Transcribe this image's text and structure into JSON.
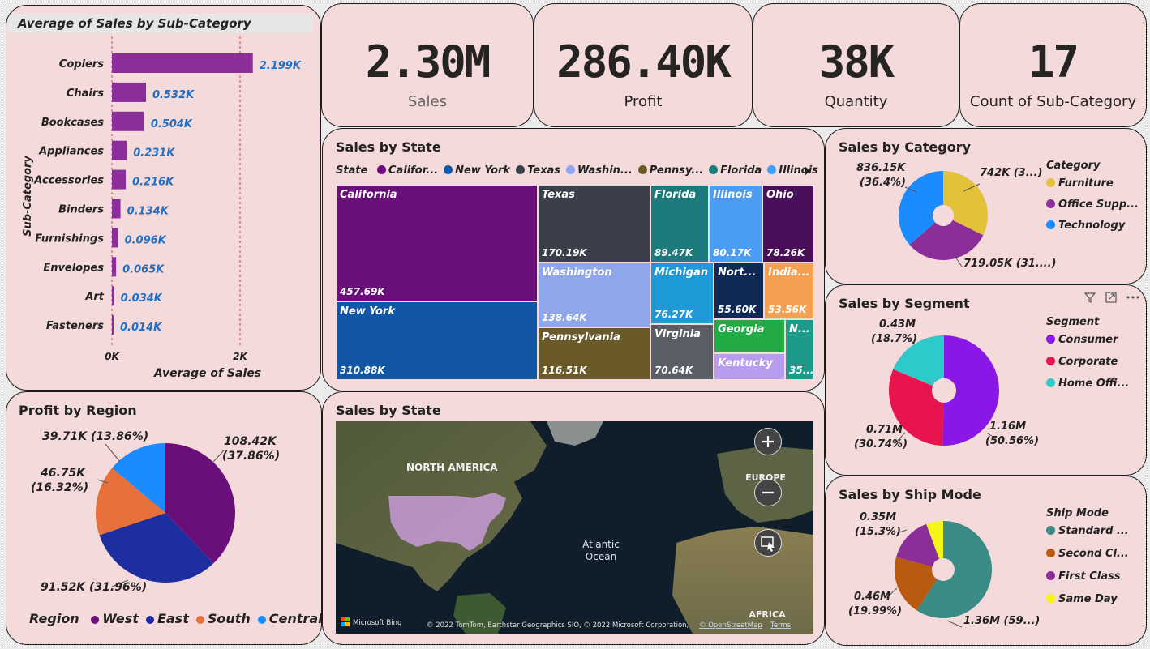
{
  "kpis": [
    {
      "value": "2.30M",
      "label": "Sales"
    },
    {
      "value": "286.40K",
      "label": "Profit"
    },
    {
      "value": "38K",
      "label": "Quantity"
    },
    {
      "value": "17",
      "label": "Count of Sub-Category"
    }
  ],
  "subcat": {
    "title": "Average of Sales by Sub-Category",
    "ylabel": "Sub-Category",
    "xlabel": "Average of Sales",
    "ticks": [
      "0K",
      "2K"
    ],
    "items": [
      {
        "name": "Copiers",
        "label": "2.199K",
        "value": 2.199
      },
      {
        "name": "Chairs",
        "label": "0.532K",
        "value": 0.532
      },
      {
        "name": "Bookcases",
        "label": "0.504K",
        "value": 0.504
      },
      {
        "name": "Appliances",
        "label": "0.231K",
        "value": 0.231
      },
      {
        "name": "Accessories",
        "label": "0.216K",
        "value": 0.216
      },
      {
        "name": "Binders",
        "label": "0.134K",
        "value": 0.134
      },
      {
        "name": "Furnishings",
        "label": "0.096K",
        "value": 0.096
      },
      {
        "name": "Envelopes",
        "label": "0.065K",
        "value": 0.065
      },
      {
        "name": "Art",
        "label": "0.034K",
        "value": 0.034
      },
      {
        "name": "Fasteners",
        "label": "0.014K",
        "value": 0.014
      }
    ],
    "bar_color": "#8b2e9a",
    "label_color": "#1f6fc5"
  },
  "treemap": {
    "title": "Sales by State",
    "legend_title": "State",
    "legend": [
      {
        "label": "Califor...",
        "color": "#6a0f7a"
      },
      {
        "label": "New York",
        "color": "#1157a6"
      },
      {
        "label": "Texas",
        "color": "#3a3f4a"
      },
      {
        "label": "Washin...",
        "color": "#8fa5ec"
      },
      {
        "label": "Pennsy...",
        "color": "#6a5a2a"
      },
      {
        "label": "Florida",
        "color": "#1d7a7a"
      },
      {
        "label": "Illinois",
        "color": "#4a9cf5"
      }
    ],
    "cells": [
      {
        "name": "California",
        "value": "457.69K",
        "color": "#6a0f7a"
      },
      {
        "name": "New York",
        "value": "310.88K",
        "color": "#1157a6"
      },
      {
        "name": "Texas",
        "value": "170.19K",
        "color": "#3a3f4a"
      },
      {
        "name": "Washington",
        "value": "138.64K",
        "color": "#8fa5ec"
      },
      {
        "name": "Pennsylvania",
        "value": "116.51K",
        "color": "#6a5a2a"
      },
      {
        "name": "Florida",
        "value": "89.47K",
        "color": "#1d7a7a"
      },
      {
        "name": "Illinois",
        "value": "80.17K",
        "color": "#4a9cf5"
      },
      {
        "name": "Ohio",
        "value": "78.26K",
        "color": "#4a0f5a"
      },
      {
        "name": "Michigan",
        "value": "76.27K",
        "color": "#1f9ad8"
      },
      {
        "name": "Virginia",
        "value": "70.64K",
        "color": "#5a5f66"
      },
      {
        "name": "Nort...",
        "value": "55.60K",
        "color": "#0f2a55"
      },
      {
        "name": "India...",
        "value": "53.56K",
        "color": "#f5a050"
      },
      {
        "name": "Georgia",
        "value": "",
        "color": "#22aa44"
      },
      {
        "name": "Kentucky",
        "value": "",
        "color": "#b89cf0"
      },
      {
        "name": "N...",
        "value": "35...",
        "color": "#1d9a8a"
      }
    ]
  },
  "category": {
    "title": "Sales by Category",
    "legend_title": "Category",
    "legend": [
      {
        "label": "Furniture",
        "color": "#e3c23a"
      },
      {
        "label": "Office Supp...",
        "color": "#8b2e9a"
      },
      {
        "label": "Technology",
        "color": "#1a8cff"
      }
    ],
    "values": [
      742,
      719.05,
      836.15
    ],
    "labels": [
      "742K (3...)",
      "719.05K (31....)",
      "836.15K",
      "(36.4%)"
    ]
  },
  "segment": {
    "title": "Sales by Segment",
    "legend_title": "Segment",
    "legend": [
      {
        "label": "Consumer",
        "color": "#8a16e8"
      },
      {
        "label": "Corporate",
        "color": "#e8144e"
      },
      {
        "label": "Home Offi...",
        "color": "#2ec9c9"
      }
    ],
    "values": [
      1.16,
      0.71,
      0.43
    ],
    "labels": [
      "1.16M",
      "(50.56%)",
      "0.71M",
      "(30.74%)",
      "0.43M",
      "(18.7%)"
    ]
  },
  "shipmode": {
    "title": "Sales by Ship Mode",
    "legend_title": "Ship Mode",
    "legend": [
      {
        "label": "Standard ...",
        "color": "#3a8a85"
      },
      {
        "label": "Second Cl...",
        "color": "#b85a10"
      },
      {
        "label": "First Class",
        "color": "#8b2e9a"
      },
      {
        "label": "Same Day",
        "color": "#f5f518"
      }
    ],
    "values": [
      1.36,
      0.46,
      0.35,
      0.13
    ],
    "labels": [
      "1.36M (59...)",
      "0.46M",
      "(19.99%)",
      "0.35M",
      "(15.3%)"
    ]
  },
  "region": {
    "title": "Profit by Region",
    "legend_title": "Region",
    "legend": [
      {
        "label": "West",
        "color": "#6a0f7a"
      },
      {
        "label": "East",
        "color": "#1c2ea0"
      },
      {
        "label": "South",
        "color": "#e8703a"
      },
      {
        "label": "Central",
        "color": "#1a8cff"
      }
    ],
    "values": [
      108.42,
      91.52,
      46.75,
      39.71
    ],
    "labels": [
      "108.42K",
      "(37.86%)",
      "91.52K (31.96%)",
      "46.75K",
      "(16.32%)",
      "39.71K (13.86%)"
    ]
  },
  "map": {
    "title": "Sales by State",
    "labels": {
      "na": "NORTH AMERICA",
      "atlantic": "Atlantic\nOcean",
      "europe": "EUROPE",
      "africa": "AFRICA"
    },
    "bing": "Microsoft Bing",
    "attribution": "© 2022 TomTom, Earthstar Geographics SIO, © 2022 Microsoft Corporation,",
    "osm": "© OpenStreetMap",
    "terms": "Terms"
  }
}
